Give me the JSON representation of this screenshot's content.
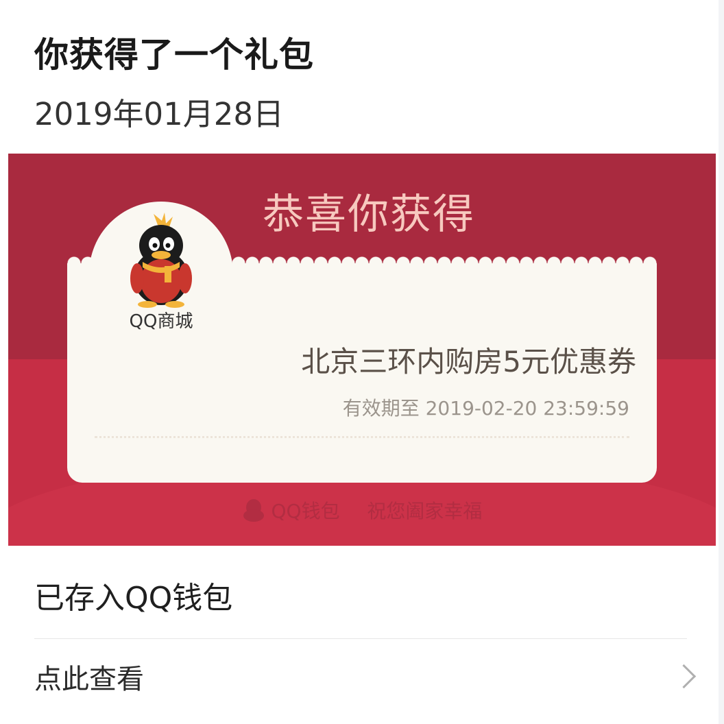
{
  "header": {
    "title": "你获得了一个礼包",
    "date": "2019年01月28日"
  },
  "card": {
    "heading": "恭喜你获得",
    "avatar_label": "QQ商城",
    "coupon_name": "北京三环内购房5元优惠券",
    "validity": "有效期至 2019-02-20 23:59:59",
    "footer_brand": "QQ钱包",
    "footer_slogan": "祝您阖家幸福",
    "colors": {
      "card_red": "#c62e45",
      "card_dark": "#a92a3f",
      "heading": "#f7c9bf",
      "coupon_bg": "#faf8f2"
    }
  },
  "status": {
    "saved_text": "已存入QQ钱包"
  },
  "action": {
    "view_label": "点此查看",
    "icon": "chevron-right-icon"
  }
}
